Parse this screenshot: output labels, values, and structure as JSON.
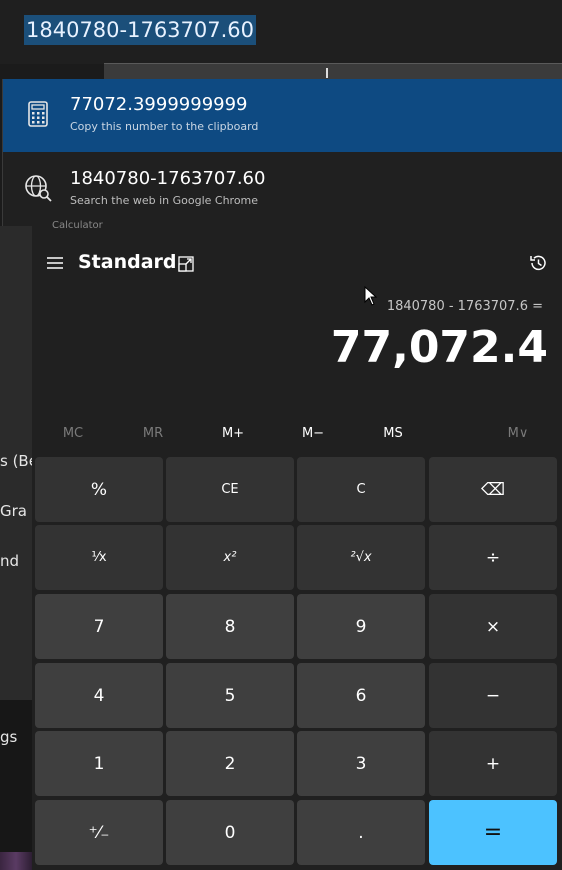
{
  "search": {
    "query": "1840780-1763707.60"
  },
  "suggestions": [
    {
      "title": "77072.3999999999",
      "subtitle": "Copy this number to the clipboard",
      "icon": "calculator-icon"
    },
    {
      "title": "1840780-1763707.60",
      "subtitle": "Search the web in Google Chrome",
      "icon": "globe-search-icon"
    }
  ],
  "background_fragments": [
    "s (Be",
    "Gra",
    "nd",
    "gs"
  ],
  "calculator": {
    "titlebar_text": "Calculator",
    "mode": "Standard",
    "expression": "1840780 - 1763707.6 =",
    "result": "77,072.4",
    "memory": {
      "mc": "MC",
      "mr": "MR",
      "mplus": "M+",
      "mminus": "M−",
      "ms": "MS",
      "mlist": "M∨"
    },
    "keys": {
      "percent": "%",
      "ce": "CE",
      "c": "C",
      "backspace": "⌫",
      "reciprocal": "¹⁄x",
      "square": "x²",
      "sqrt": "²√x",
      "divide": "÷",
      "seven": "7",
      "eight": "8",
      "nine": "9",
      "multiply": "×",
      "four": "4",
      "five": "5",
      "six": "6",
      "minus": "−",
      "one": "1",
      "two": "2",
      "three": "3",
      "plus": "+",
      "negate": "⁺⁄₋",
      "zero": "0",
      "decimal": ".",
      "equals": "="
    },
    "accent_color": "#4cc2ff"
  }
}
